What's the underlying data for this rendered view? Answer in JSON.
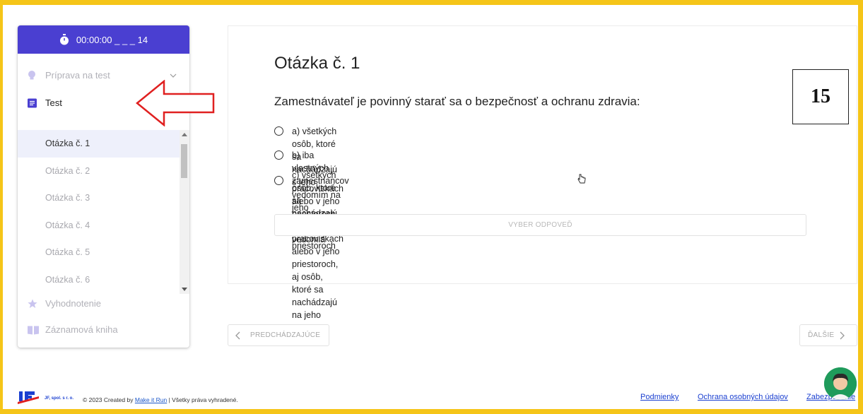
{
  "sidebar": {
    "timer": "00:00:00 _ _ _ 14",
    "prep": "Príprava na test",
    "test": "Test",
    "questions": [
      "Otázka č. 1",
      "Otázka č. 2",
      "Otázka č. 3",
      "Otázka č. 4",
      "Otázka č. 5",
      "Otázka č. 6"
    ],
    "evaluation": "Vyhodnotenie",
    "logbook": "Záznamová kniha"
  },
  "main": {
    "title": "Otázka č. 1",
    "question": "Zamestnávateľ je povinný starať sa o bezpečnosť a ochranu zdravia:",
    "options": [
      "a) všetkých osôb, ktoré sa nachádzajú s jeho vedomím na jeho pracoviskách alebo v jeho priestoroch",
      "b) iba vlastných zamestnancov",
      "c) všetkých osôb, ktoré sa nachádzajú na jeho pracoviskách alebo v jeho priestoroch, aj osôb, ktoré sa nachádzajú na jeho",
      "pracoviskách alebo v jeho priestoroch bez jeho vedomia"
    ],
    "select_button": "VYBER ODPOVEĎ",
    "prev_button": "PREDCHÁDZAJÚCE",
    "next_button": "ĎALŠIE"
  },
  "overlay_number": "15",
  "footer": {
    "company": "JF, spol. s r. o.",
    "copyright_prefix": "© 2023 Created by",
    "creator": "Make it Run",
    "rights": "| Všetky práva vyhradené.",
    "links": [
      "Podmienky",
      "Ochrana osobných údajov",
      "Zabezpečenie"
    ]
  },
  "colors": {
    "accent": "#4a3fd1",
    "frame": "#f5c518",
    "arrow": "#e02020"
  }
}
